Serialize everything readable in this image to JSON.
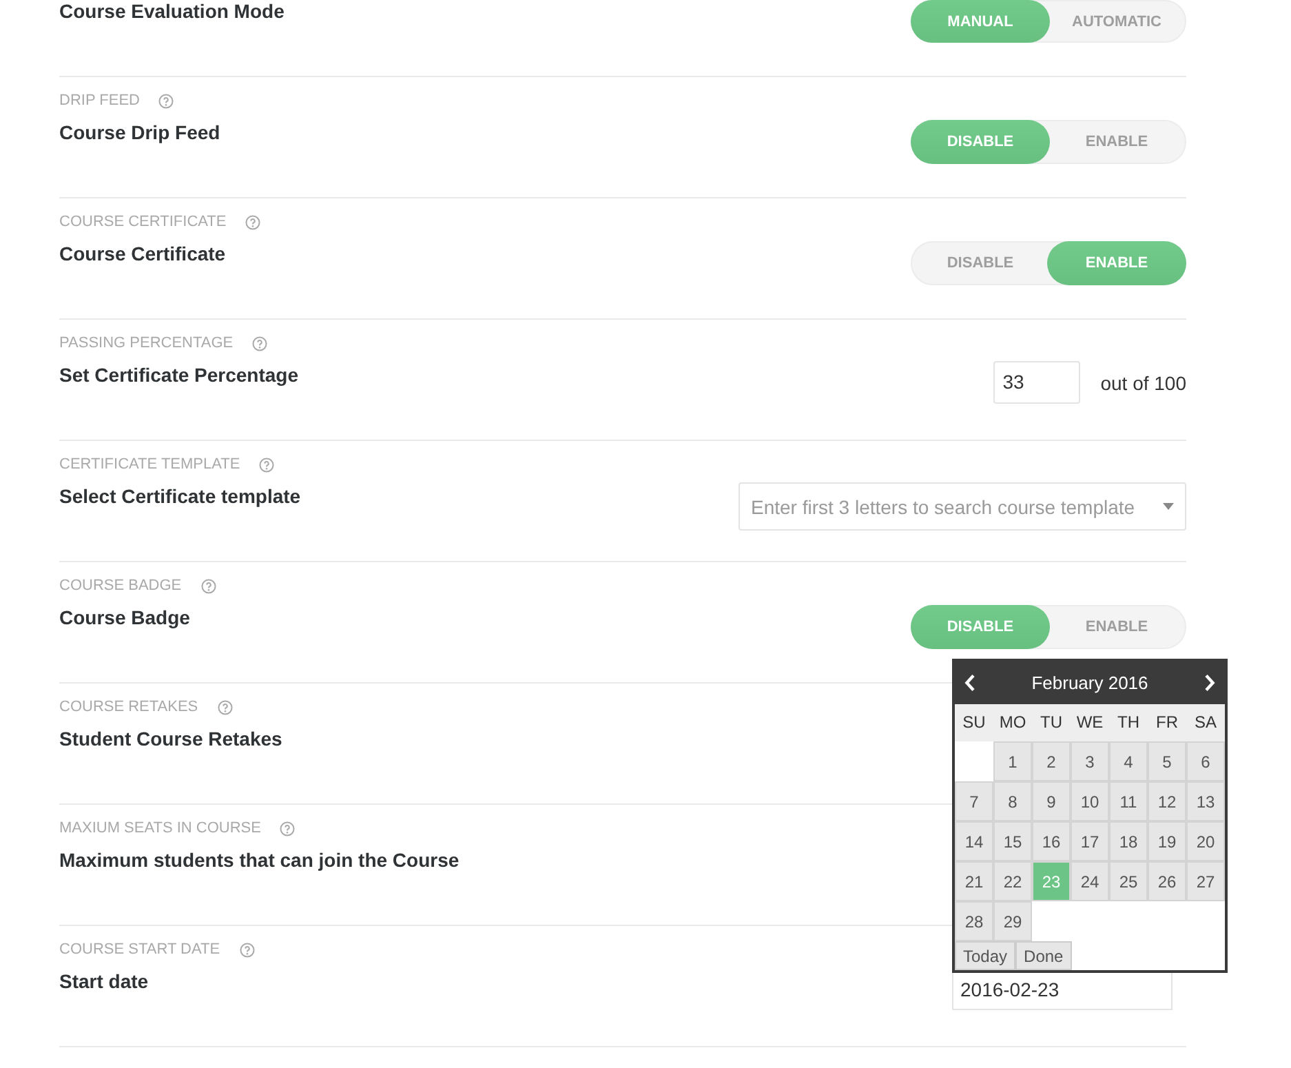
{
  "settings": [
    {
      "kind": "toggle",
      "title": "Course Evaluation Mode",
      "options": [
        {
          "label": "MANUAL",
          "selected": true
        },
        {
          "label": "AUTOMATIC",
          "selected": false
        }
      ]
    },
    {
      "kind": "toggle",
      "label": "DRIP FEED",
      "title": "Course Drip Feed",
      "options": [
        {
          "label": "DISABLE",
          "selected": true
        },
        {
          "label": "ENABLE",
          "selected": false
        }
      ]
    },
    {
      "kind": "toggle",
      "label": "COURSE CERTIFICATE",
      "title": "Course Certificate",
      "options": [
        {
          "label": "DISABLE",
          "selected": false
        },
        {
          "label": "ENABLE",
          "selected": true
        }
      ]
    },
    {
      "kind": "number",
      "label": "PASSING PERCENTAGE",
      "title": "Set Certificate Percentage",
      "value": "33",
      "suffix": "out of 100"
    },
    {
      "kind": "select",
      "label": "CERTIFICATE TEMPLATE",
      "title": "Select Certificate template",
      "placeholder": "Enter first 3 letters to search course template"
    },
    {
      "kind": "toggle",
      "label": "COURSE BADGE",
      "title": "Course Badge",
      "options": [
        {
          "label": "DISABLE",
          "selected": true
        },
        {
          "label": "ENABLE",
          "selected": false
        }
      ]
    },
    {
      "kind": "plain",
      "label": "COURSE RETAKES",
      "title": "Student Course Retakes"
    },
    {
      "kind": "plain",
      "label": "MAXIUM SEATS IN COURSE",
      "title": "Maximum students that can join the Course"
    },
    {
      "kind": "date",
      "label": "COURSE START DATE",
      "title": "Start date",
      "value": "2016-02-23",
      "datepicker": {
        "title": "February 2016",
        "weekdays": [
          "SU",
          "MO",
          "TU",
          "WE",
          "TH",
          "FR",
          "SA"
        ],
        "weeks": [
          [
            {
              "label": "1",
              "selected": false
            },
            {
              "label": "2",
              "selected": false
            },
            {
              "label": "3",
              "selected": false
            },
            {
              "label": "4",
              "selected": false
            },
            {
              "label": "5",
              "selected": false
            },
            {
              "label": "6",
              "selected": false
            }
          ],
          [
            {
              "label": "7",
              "selected": false
            },
            {
              "label": "8",
              "selected": false
            },
            {
              "label": "9",
              "selected": false
            },
            {
              "label": "10",
              "selected": false
            },
            {
              "label": "11",
              "selected": false
            },
            {
              "label": "12",
              "selected": false
            },
            {
              "label": "13",
              "selected": false
            }
          ],
          [
            {
              "label": "14",
              "selected": false
            },
            {
              "label": "15",
              "selected": false
            },
            {
              "label": "16",
              "selected": false
            },
            {
              "label": "17",
              "selected": false
            },
            {
              "label": "18",
              "selected": false
            },
            {
              "label": "19",
              "selected": false
            },
            {
              "label": "20",
              "selected": false
            }
          ],
          [
            {
              "label": "21",
              "selected": false
            },
            {
              "label": "22",
              "selected": false
            },
            {
              "label": "23",
              "selected": true
            },
            {
              "label": "24",
              "selected": false
            },
            {
              "label": "25",
              "selected": false
            },
            {
              "label": "26",
              "selected": false
            },
            {
              "label": "27",
              "selected": false
            }
          ],
          [
            {
              "label": "28",
              "selected": false
            },
            {
              "label": "29",
              "selected": false
            }
          ]
        ],
        "buttons": [
          "Today",
          "Done"
        ]
      }
    }
  ]
}
